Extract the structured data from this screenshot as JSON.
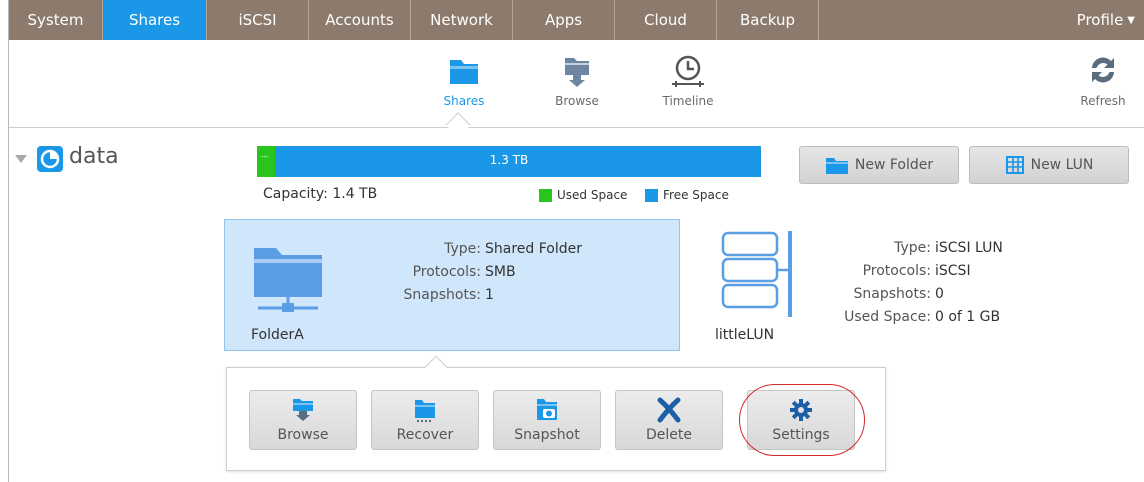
{
  "nav": {
    "tabs": [
      {
        "label": "System",
        "width": 94
      },
      {
        "label": "Shares",
        "width": 104,
        "active": true
      },
      {
        "label": "iSCSI",
        "width": 102
      },
      {
        "label": "Accounts",
        "width": 102
      },
      {
        "label": "Network",
        "width": 102
      },
      {
        "label": "Apps",
        "width": 102
      },
      {
        "label": "Cloud",
        "width": 102
      },
      {
        "label": "Backup",
        "width": 102
      }
    ],
    "profile_label": "Profile"
  },
  "subnav": {
    "shares_label": "Shares",
    "browse_label": "Browse",
    "timeline_label": "Timeline",
    "refresh_label": "Refresh"
  },
  "volume": {
    "name": "data",
    "used_label": "---",
    "free_label": "1.3 TB",
    "used_fraction": 0.035,
    "capacity_text": "Capacity: 1.4 TB",
    "legend_used": "Used Space",
    "legend_free": "Free Space",
    "new_folder_label": "New Folder",
    "new_lun_label": "New LUN"
  },
  "folder": {
    "name": "FolderA",
    "type_key": "Type:",
    "type_val": "Shared Folder",
    "protocols_key": "Protocols:",
    "protocols_val": "SMB",
    "snapshots_key": "Snapshots:",
    "snapshots_val": "1"
  },
  "lun": {
    "name": "littleLUN",
    "type_key": "Type:",
    "type_val": "iSCSI LUN",
    "protocols_key": "Protocols:",
    "protocols_val": "iSCSI",
    "snapshots_key": "Snapshots:",
    "snapshots_val": "0",
    "used_key": "Used Space:",
    "used_val": "0 of 1 GB"
  },
  "actions": {
    "browse": "Browse",
    "recover": "Recover",
    "snapshot": "Snapshot",
    "delete": "Delete",
    "settings": "Settings"
  },
  "colors": {
    "nav_bg": "#8c7b6d",
    "accent": "#1b97e8",
    "used": "#29c51c",
    "selected_card": "#cfe6fb"
  }
}
